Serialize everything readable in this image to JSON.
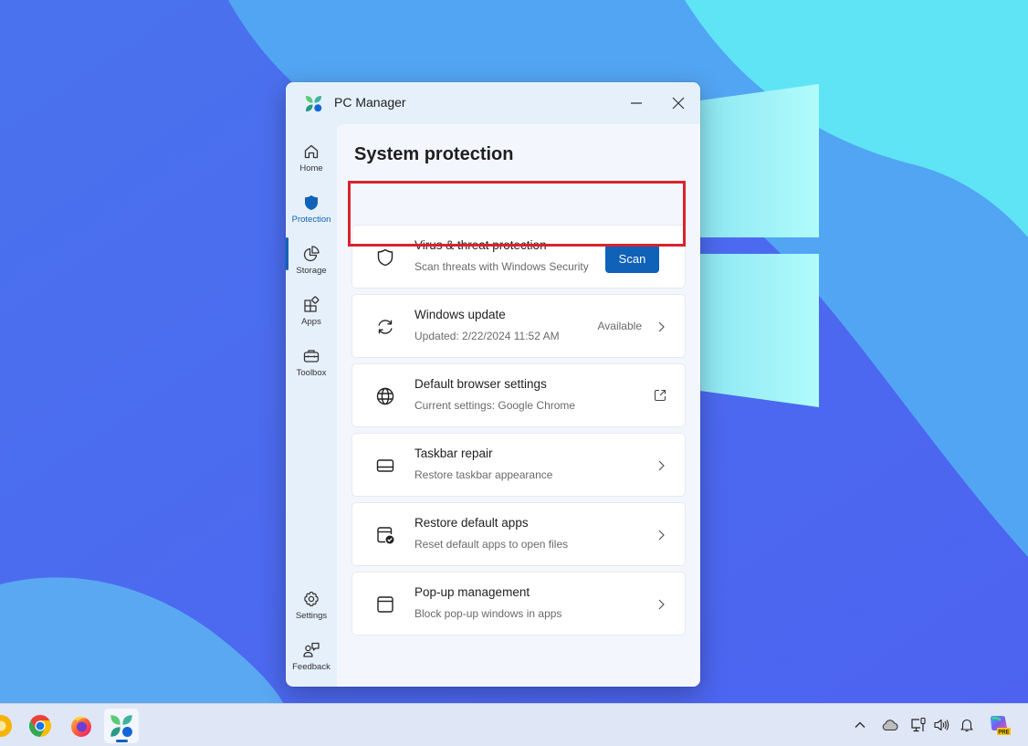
{
  "window": {
    "title": "PC Manager",
    "minimize_label": "Minimize",
    "close_label": "Close"
  },
  "sidebar": {
    "items": [
      {
        "id": "home",
        "label": "Home",
        "icon": "home-icon",
        "active": false
      },
      {
        "id": "protection",
        "label": "Protection",
        "icon": "shield-icon",
        "active": true
      },
      {
        "id": "storage",
        "label": "Storage",
        "icon": "pie-chart-icon",
        "active": false
      },
      {
        "id": "apps",
        "label": "Apps",
        "icon": "apps-icon",
        "active": false
      },
      {
        "id": "toolbox",
        "label": "Toolbox",
        "icon": "toolbox-icon",
        "active": false
      }
    ],
    "bottom_items": [
      {
        "id": "settings",
        "label": "Settings",
        "icon": "gear-icon"
      },
      {
        "id": "feedback",
        "label": "Feedback",
        "icon": "feedback-icon"
      }
    ]
  },
  "main": {
    "title": "System protection",
    "cards": [
      {
        "title": "Virus & threat protection",
        "subtitle": "Scan threats with Windows Security",
        "icon": "shield-outline-icon",
        "action": "button",
        "button_label": "Scan",
        "highlighted": true
      },
      {
        "title": "Windows update",
        "subtitle": "Updated: 2/22/2024 11:52 AM",
        "icon": "sync-icon",
        "status": "Available",
        "action": "chevron"
      },
      {
        "title": "Default browser settings",
        "subtitle": "Current settings: Google Chrome",
        "icon": "globe-icon",
        "action": "external-link"
      },
      {
        "title": "Taskbar repair",
        "subtitle": "Restore taskbar appearance",
        "icon": "taskbar-icon",
        "action": "chevron"
      },
      {
        "title": "Restore default apps",
        "subtitle": "Reset default apps to open files",
        "icon": "app-check-icon",
        "action": "chevron"
      },
      {
        "title": "Pop-up management",
        "subtitle": "Block pop-up windows in apps",
        "icon": "window-icon",
        "action": "chevron"
      }
    ]
  },
  "colors": {
    "accent": "#0f62b8",
    "highlight": "#d9232d",
    "window_bg": "#e6f0fb",
    "content_bg": "#f3f7fd"
  },
  "taskbar": {
    "apps": [
      {
        "name": "Google Chrome Canary (partial)",
        "icon": "chrome-canary-icon"
      },
      {
        "name": "Google Chrome",
        "icon": "chrome-icon"
      },
      {
        "name": "Firefox",
        "icon": "firefox-icon"
      },
      {
        "name": "PC Manager",
        "icon": "pc-manager-icon",
        "active": true
      }
    ],
    "tray": [
      {
        "name": "Show hidden icons",
        "icon": "chevron-up-icon"
      },
      {
        "name": "OneDrive",
        "icon": "cloud-icon"
      },
      {
        "name": "Network",
        "icon": "network-icon"
      },
      {
        "name": "Volume",
        "icon": "speaker-icon"
      },
      {
        "name": "Notifications",
        "icon": "bell-icon"
      },
      {
        "name": "Copilot",
        "icon": "copilot-icon",
        "badge": "PRE"
      }
    ]
  }
}
